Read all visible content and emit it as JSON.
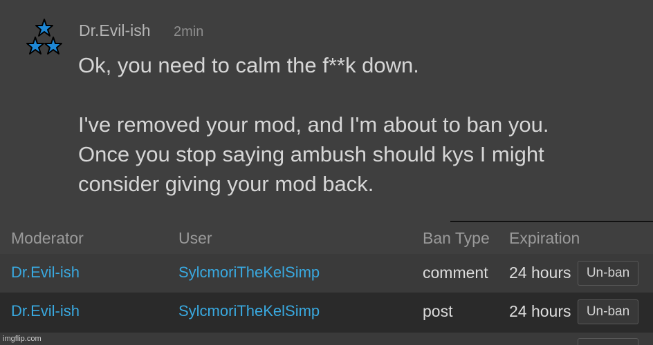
{
  "comment": {
    "author": "Dr.Evil-ish",
    "time": "2min",
    "lines": [
      "Ok, you need to calm the f**k down.",
      "",
      "I've removed your mod, and I'm about to ban you.",
      "Once you stop saying ambush should kys I might",
      "consider giving your mod back."
    ],
    "avatar_icon": "three-stars-icon"
  },
  "ban_table": {
    "headers": {
      "moderator": "Moderator",
      "user": "User",
      "ban_type": "Ban Type",
      "expiration": "Expiration"
    },
    "rows": [
      {
        "moderator": "Dr.Evil-ish",
        "user": "SylcmoriTheKelSimp",
        "ban_type": "comment",
        "expiration": "24 hours",
        "action": "Un-ban"
      },
      {
        "moderator": "Dr.Evil-ish",
        "user": "SylcmoriTheKelSimp",
        "ban_type": "post",
        "expiration": "24 hours",
        "action": "Un-ban"
      }
    ]
  },
  "watermark": "imgflip.com",
  "colors": {
    "background": "#3f3f3f",
    "link": "#39a9e0",
    "text": "#d6d6d6",
    "star_fill": "#1e88d6"
  }
}
